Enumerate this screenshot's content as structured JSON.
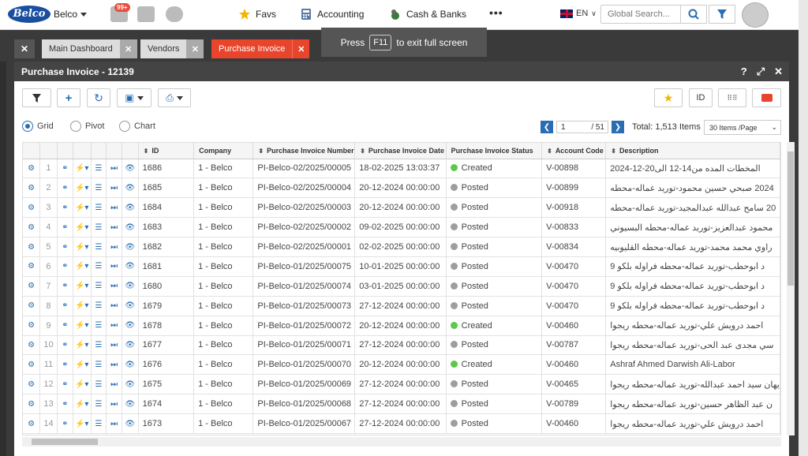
{
  "topbar": {
    "logo_text": "Belco",
    "company": "Belco",
    "notification_count": "99+",
    "nav": [
      {
        "label": "Favs",
        "icon": "star-icon"
      },
      {
        "label": "Accounting",
        "icon": "calculator-icon"
      },
      {
        "label": "Cash & Banks",
        "icon": "money-icon"
      }
    ],
    "more": "•••",
    "language": "EN",
    "search_placeholder": "Global Search..."
  },
  "tabs": [
    {
      "label": "Main Dashboard",
      "active": false
    },
    {
      "label": "Vendors",
      "active": false
    },
    {
      "label": "Purchase Invoice",
      "active": true
    }
  ],
  "toast": {
    "prefix": "Press",
    "key": "F11",
    "suffix": "to exit full screen"
  },
  "panel": {
    "title": "Purchase Invoice - 12139",
    "id_button": "ID"
  },
  "views": {
    "grid": "Grid",
    "pivot": "Pivot",
    "chart": "Chart",
    "selected": "Grid"
  },
  "pager": {
    "page": "1",
    "total_pages": "/ 51",
    "total_label": "Total: 1,513 Items",
    "per_page": "30 Items /Page"
  },
  "table": {
    "columns": [
      "ID",
      "Company",
      "Purchase Invoice Number",
      "Purchase Invoice Date",
      "Purchase Invoice Status",
      "Account Code",
      "Description"
    ],
    "status_colors": {
      "Created": "#5cc84a",
      "Posted": "#9e9e9e"
    },
    "rows": [
      {
        "n": "1",
        "id": "1686",
        "company": "1 - Belco",
        "number": "PI-Belco-02/2025/00005",
        "date": "18-02-2025 13:03:37",
        "status": "Created",
        "account": "V-00898",
        "desc": "المخطات المده من14-12 الى20-12-2024"
      },
      {
        "n": "2",
        "id": "1685",
        "company": "1 - Belco",
        "number": "PI-Belco-02/2025/00004",
        "date": "20-12-2024 00:00:00",
        "status": "Posted",
        "account": "V-00899",
        "desc": "2024 صبحي حسين محمود-توريد عماله-محطه"
      },
      {
        "n": "3",
        "id": "1684",
        "company": "1 - Belco",
        "number": "PI-Belco-02/2025/00003",
        "date": "20-12-2024 00:00:00",
        "status": "Posted",
        "account": "V-00918",
        "desc": "20 سامح عبدالله عبدالمجيد-توريد عماله-محطه"
      },
      {
        "n": "4",
        "id": "1683",
        "company": "1 - Belco",
        "number": "PI-Belco-02/2025/00002",
        "date": "09-02-2025 00:00:00",
        "status": "Posted",
        "account": "V-00833",
        "desc": "محمود عبدالعزيز-توريد عماله-محطه البسيوني"
      },
      {
        "n": "5",
        "id": "1682",
        "company": "1 - Belco",
        "number": "PI-Belco-02/2025/00001",
        "date": "02-02-2025 00:00:00",
        "status": "Posted",
        "account": "V-00834",
        "desc": "راوي محمد محمد-توريد عماله-محطه القليوبيه"
      },
      {
        "n": "6",
        "id": "1681",
        "company": "1 - Belco",
        "number": "PI-Belco-01/2025/00075",
        "date": "10-01-2025 00:00:00",
        "status": "Posted",
        "account": "V-00470",
        "desc": "د ابوحطب-توريد عماله-محطه فراوله بلكو 9"
      },
      {
        "n": "7",
        "id": "1680",
        "company": "1 - Belco",
        "number": "PI-Belco-01/2025/00074",
        "date": "03-01-2025 00:00:00",
        "status": "Posted",
        "account": "V-00470",
        "desc": "د ابوحطب-توريد عماله-محطه فراوله بلكو 9"
      },
      {
        "n": "8",
        "id": "1679",
        "company": "1 - Belco",
        "number": "PI-Belco-01/2025/00073",
        "date": "27-12-2024 00:00:00",
        "status": "Posted",
        "account": "V-00470",
        "desc": "د ابوحطب-توريد عماله-محطه فراوله بلكو 9"
      },
      {
        "n": "9",
        "id": "1678",
        "company": "1 - Belco",
        "number": "PI-Belco-01/2025/00072",
        "date": "20-12-2024 00:00:00",
        "status": "Created",
        "account": "V-00460",
        "desc": "احمد درويش علي-توريد عماله-محطه ريجوا"
      },
      {
        "n": "10",
        "id": "1677",
        "company": "1 - Belco",
        "number": "PI-Belco-01/2025/00071",
        "date": "27-12-2024 00:00:00",
        "status": "Posted",
        "account": "V-00787",
        "desc": "سي مجدى عبد الحى-توريد عماله-محطه ريجوا"
      },
      {
        "n": "11",
        "id": "1676",
        "company": "1 - Belco",
        "number": "PI-Belco-01/2025/00070",
        "date": "20-12-2024 00:00:00",
        "status": "Created",
        "account": "V-00460",
        "desc": "Ashraf Ahmed Darwish Ali-Labor"
      },
      {
        "n": "12",
        "id": "1675",
        "company": "1 - Belco",
        "number": "PI-Belco-01/2025/00069",
        "date": "27-12-2024 00:00:00",
        "status": "Posted",
        "account": "V-00465",
        "desc": "يهان سيد احمد عبدالله-توريد عماله-محطه ريجوا"
      },
      {
        "n": "13",
        "id": "1674",
        "company": "1 - Belco",
        "number": "PI-Belco-01/2025/00068",
        "date": "27-12-2024 00:00:00",
        "status": "Posted",
        "account": "V-00789",
        "desc": "ن عبد الظاهر حسين-توريد عماله-محطه ريجوا"
      },
      {
        "n": "14",
        "id": "1673",
        "company": "1 - Belco",
        "number": "PI-Belco-01/2025/00067",
        "date": "27-12-2024 00:00:00",
        "status": "Posted",
        "account": "V-00460",
        "desc": "احمد درويش علي-توريد عماله-محطه ريجوا"
      }
    ]
  }
}
